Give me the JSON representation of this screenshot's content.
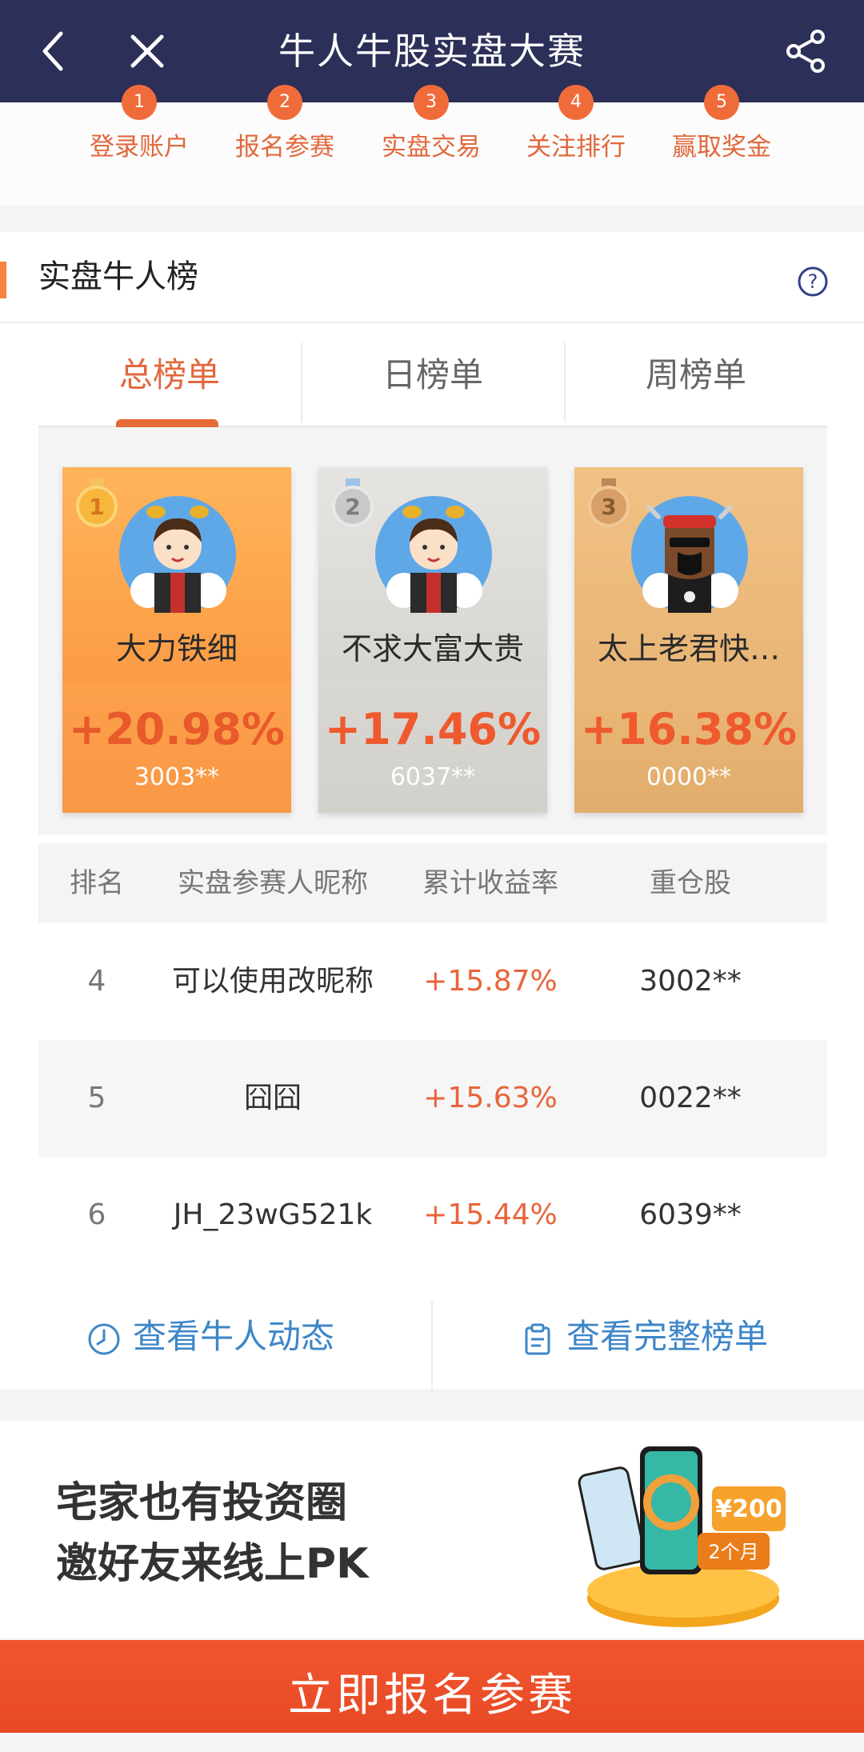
{
  "topbar": {
    "title": "牛人牛股实盘大赛",
    "back_icon": "back-arrow-icon",
    "close_icon": "close-icon",
    "share_icon": "share-icon"
  },
  "steps": [
    {
      "num": "1",
      "label": "登录账户"
    },
    {
      "num": "2",
      "label": "报名参赛"
    },
    {
      "num": "3",
      "label": "实盘交易"
    },
    {
      "num": "4",
      "label": "关注排行"
    },
    {
      "num": "5",
      "label": "赢取奖金"
    }
  ],
  "leaderboard": {
    "title": "实盘牛人榜",
    "help_icon": "help-icon",
    "tabs": [
      {
        "label": "总榜单",
        "active": true
      },
      {
        "label": "日榜单",
        "active": false
      },
      {
        "label": "周榜单",
        "active": false
      }
    ],
    "podium": [
      {
        "rank": "1",
        "name": "大力铁细",
        "rate": "+20.98%",
        "code": "3003**"
      },
      {
        "rank": "2",
        "name": "不求大富大贵",
        "rate": "+17.46%",
        "code": "6037**"
      },
      {
        "rank": "3",
        "name": "太上老君快…",
        "rate": "+16.38%",
        "code": "0000**"
      }
    ],
    "columns": [
      "排名",
      "实盘参赛人昵称",
      "累计收益率",
      "重仓股"
    ],
    "rows": [
      {
        "rank": "4",
        "name": "可以使用改昵称",
        "rate": "+15.87%",
        "stock": "3002**"
      },
      {
        "rank": "5",
        "name": "囧囧",
        "rate": "+15.63%",
        "stock": "0022**"
      },
      {
        "rank": "6",
        "name": "JH_23wG521k",
        "rate": "+15.44%",
        "stock": "6039**"
      }
    ],
    "actions": {
      "dynamics": "查看牛人动态",
      "full_list": "查看完整榜单"
    }
  },
  "promo": {
    "line1": "宅家也有投资圈",
    "line2": "邀好友来线上PK",
    "badge_amount": "¥200",
    "badge_period": "2个月"
  },
  "cta": {
    "label": "立即报名参赛"
  },
  "colors": {
    "nav_bg": "#2c2f57",
    "accent": "#e9643a",
    "link": "#3e86c8",
    "cta": "#ee5230"
  }
}
